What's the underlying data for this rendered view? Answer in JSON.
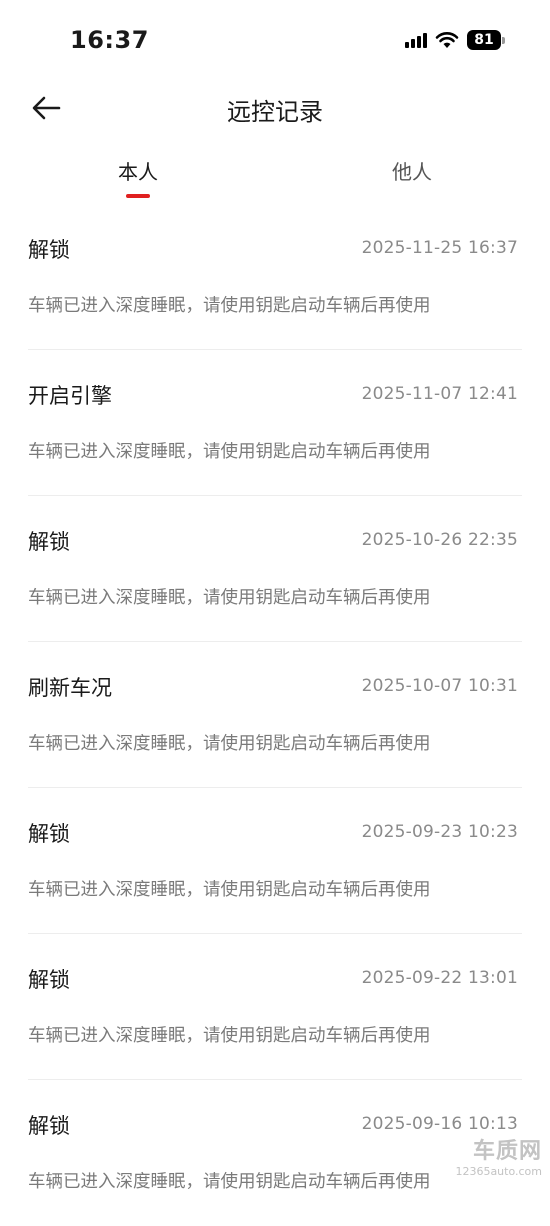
{
  "status_bar": {
    "time": "16:37",
    "battery": "81"
  },
  "header": {
    "title": "远控记录"
  },
  "tabs": [
    {
      "label": "本人",
      "active": true
    },
    {
      "label": "他人",
      "active": false
    }
  ],
  "records": [
    {
      "action": "解锁",
      "time": "2025-11-25 16:37",
      "message": "车辆已进入深度睡眠，请使用钥匙启动车辆后再使用"
    },
    {
      "action": "开启引擎",
      "time": "2025-11-07 12:41",
      "message": "车辆已进入深度睡眠，请使用钥匙启动车辆后再使用"
    },
    {
      "action": "解锁",
      "time": "2025-10-26 22:35",
      "message": "车辆已进入深度睡眠，请使用钥匙启动车辆后再使用"
    },
    {
      "action": "刷新车况",
      "time": "2025-10-07 10:31",
      "message": "车辆已进入深度睡眠，请使用钥匙启动车辆后再使用"
    },
    {
      "action": "解锁",
      "time": "2025-09-23 10:23",
      "message": "车辆已进入深度睡眠，请使用钥匙启动车辆后再使用"
    },
    {
      "action": "解锁",
      "time": "2025-09-22 13:01",
      "message": "车辆已进入深度睡眠，请使用钥匙启动车辆后再使用"
    },
    {
      "action": "解锁",
      "time": "2025-09-16 10:13",
      "message": "车辆已进入深度睡眠，请使用钥匙启动车辆后再使用"
    }
  ],
  "watermark": {
    "logo": "车质网",
    "url": "12365auto.com"
  },
  "colors": {
    "accent": "#e02020",
    "text_primary": "#1a1a1a",
    "text_secondary": "#7a7a7a",
    "divider": "#ededed"
  },
  "icons": {
    "back": "arrow-left-icon",
    "signal": "cellular-signal-icon",
    "wifi": "wifi-icon",
    "battery": "battery-icon"
  }
}
